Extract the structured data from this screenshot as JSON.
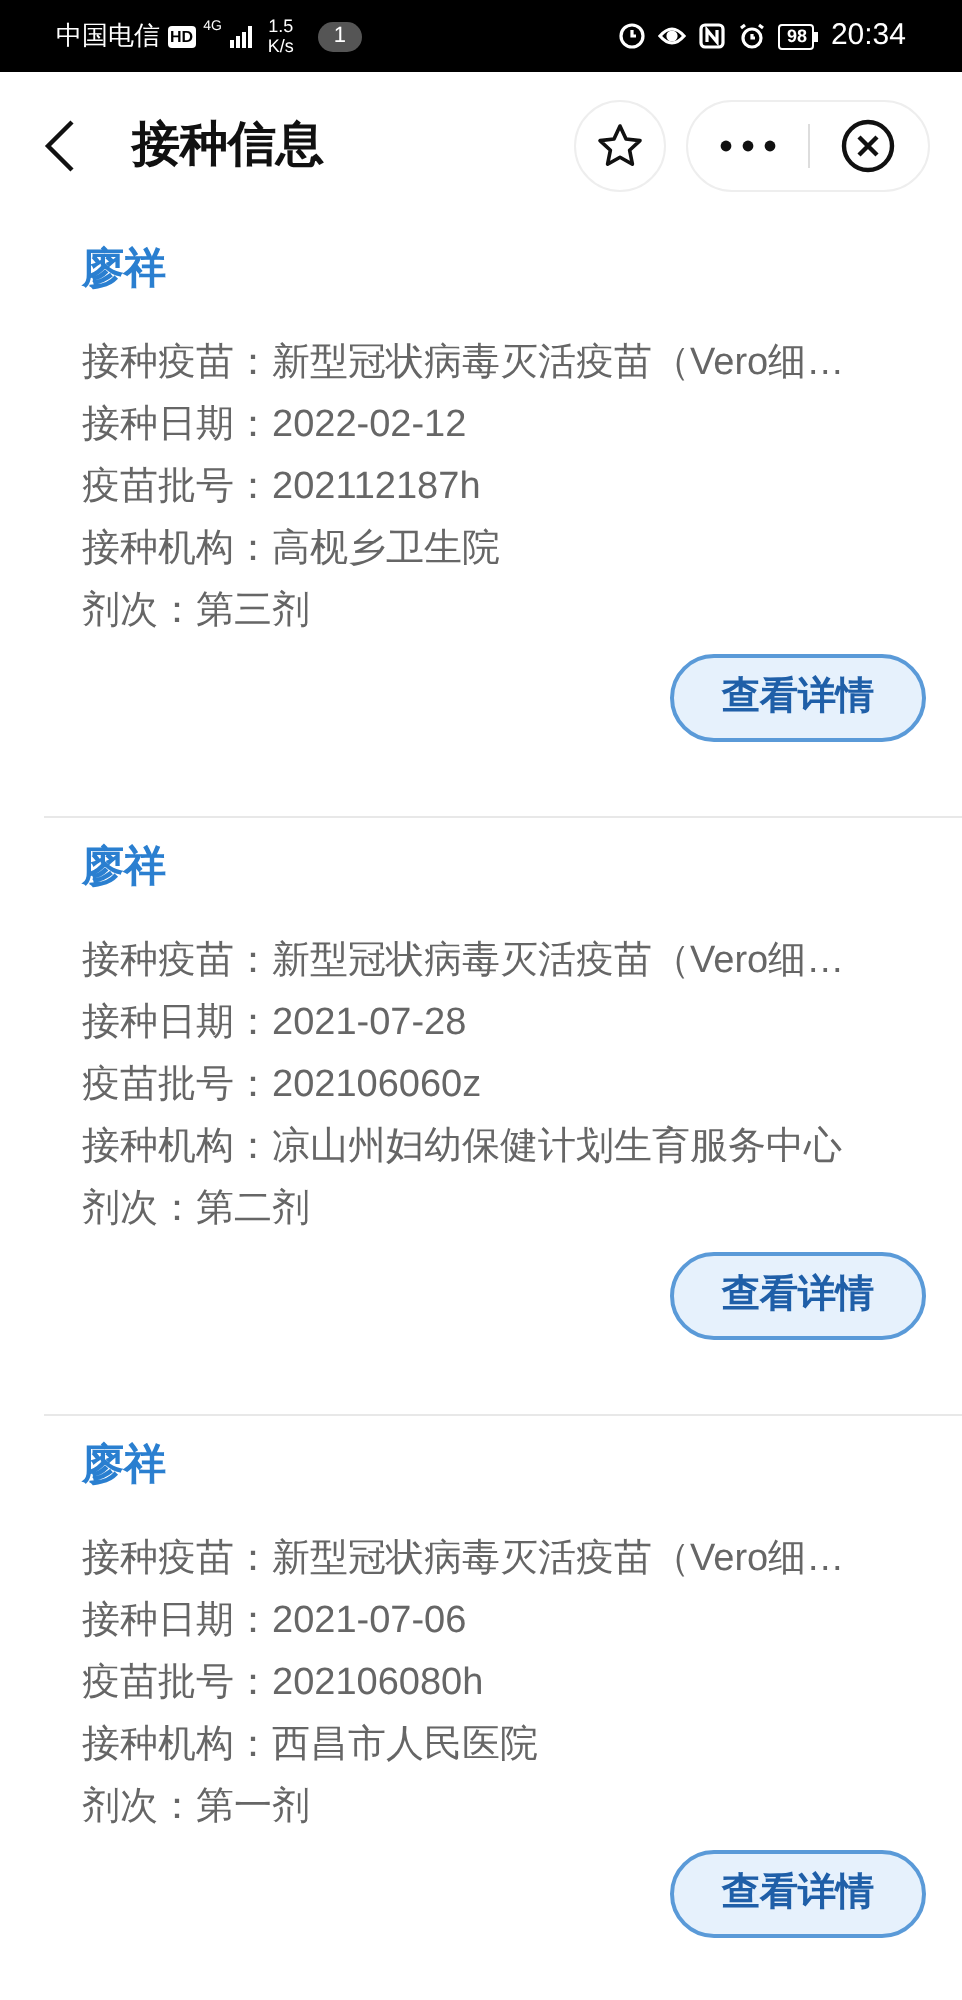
{
  "status_bar": {
    "carrier": "中国电信",
    "hd": "HD",
    "network": "4G",
    "speed": "1.5",
    "speed_unit": "K/s",
    "notifications": "1",
    "battery": "98",
    "time": "20:34"
  },
  "header": {
    "title": "接种信息"
  },
  "records": [
    {
      "name": "廖祥",
      "lines": [
        "接种疫苗：新型冠状病毒灭活疫苗（Vero细…",
        "接种日期：2022-02-12",
        "疫苗批号：202112187h",
        "接种机构：高枧乡卫生院",
        "剂次：第三剂"
      ],
      "button": "查看详情"
    },
    {
      "name": "廖祥",
      "lines": [
        "接种疫苗：新型冠状病毒灭活疫苗（Vero细…",
        "接种日期：2021-07-28",
        "疫苗批号：202106060z",
        "接种机构：凉山州妇幼保健计划生育服务中心",
        "剂次：第二剂"
      ],
      "button": "查看详情"
    },
    {
      "name": "廖祥",
      "lines": [
        "接种疫苗：新型冠状病毒灭活疫苗（Vero细…",
        "接种日期：2021-07-06",
        "疫苗批号：202106080h",
        "接种机构：西昌市人民医院",
        "剂次：第一剂"
      ],
      "button": "查看详情"
    }
  ]
}
